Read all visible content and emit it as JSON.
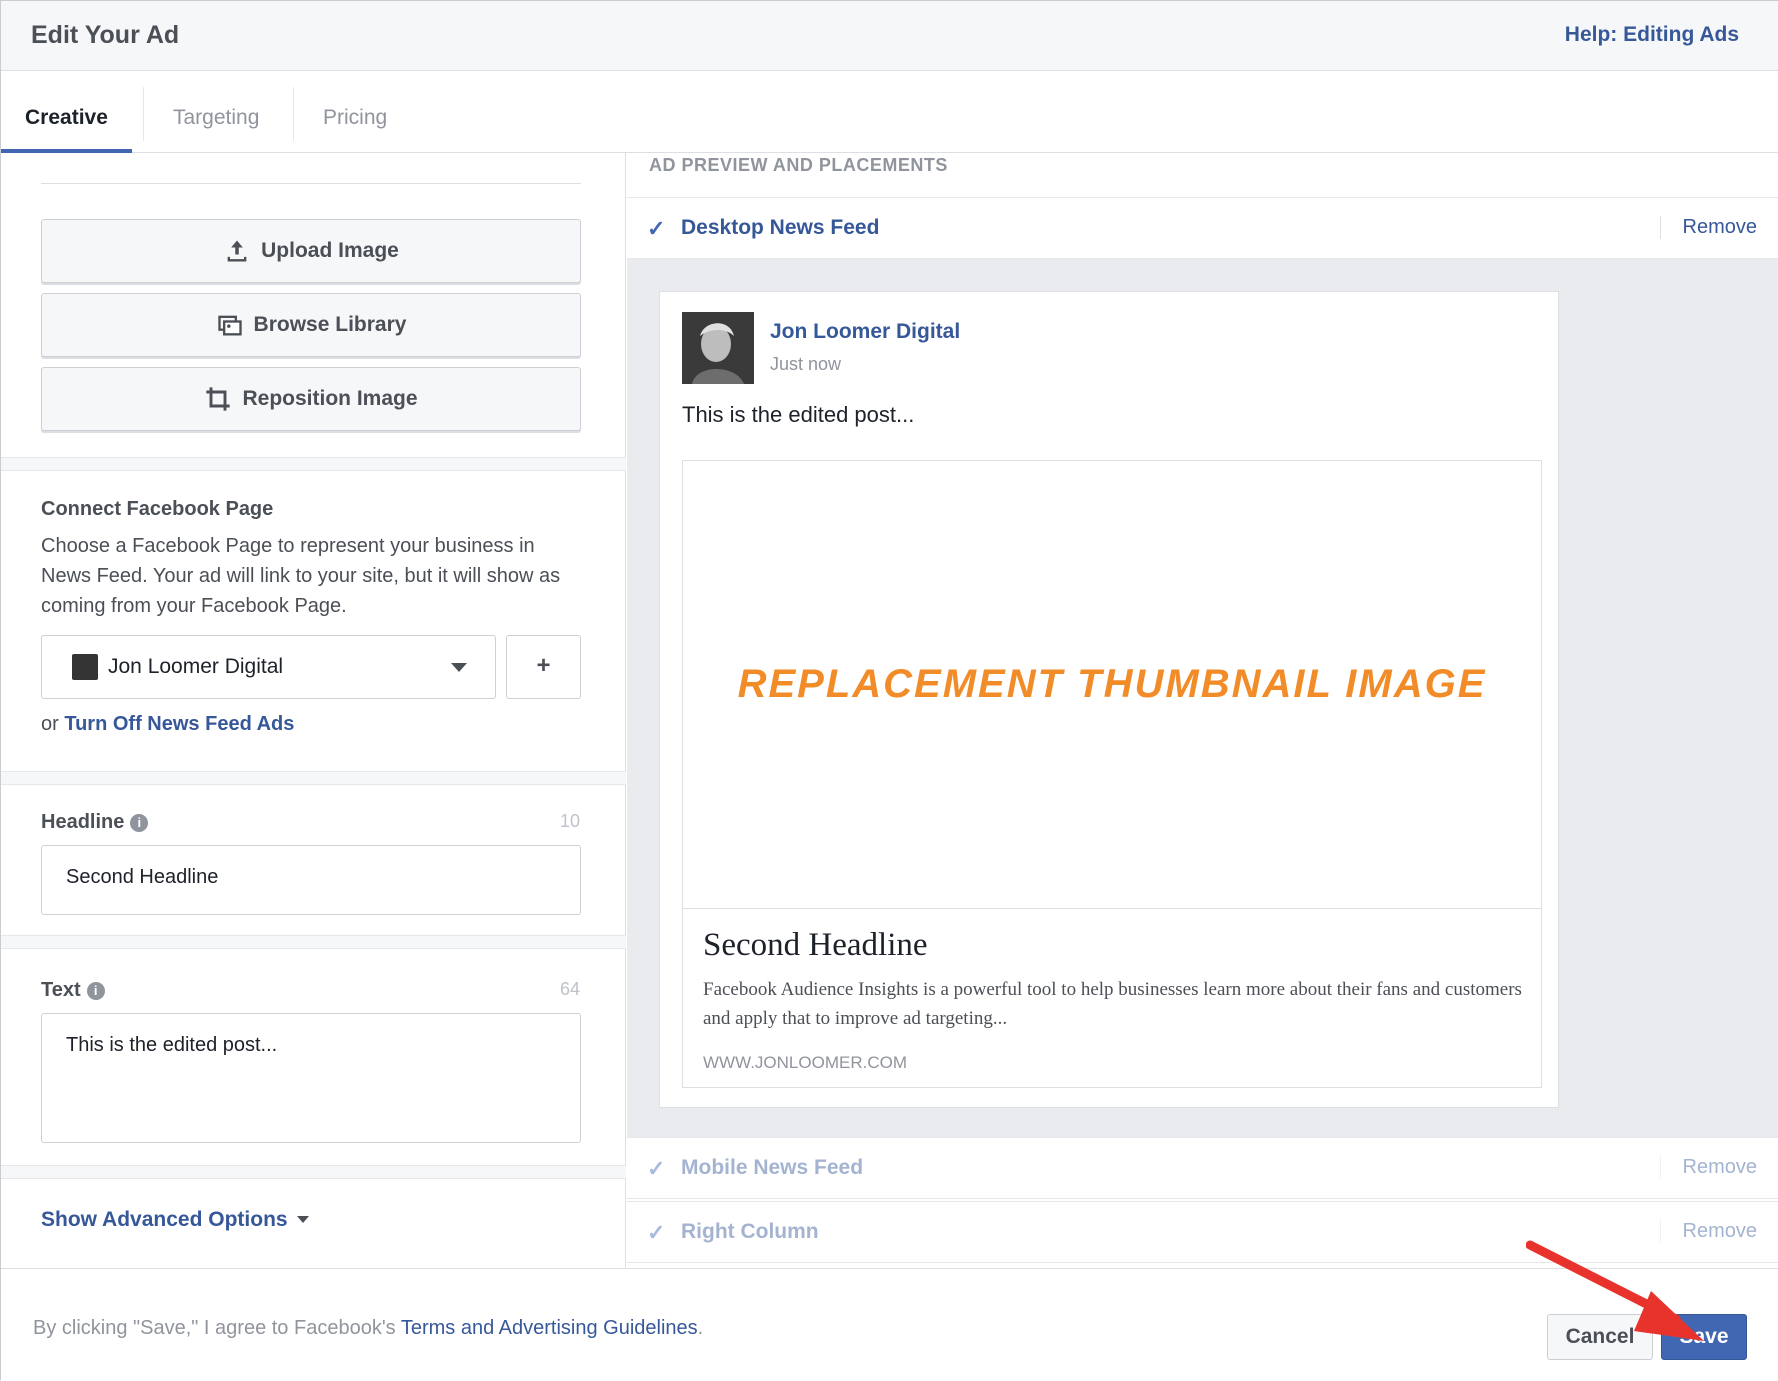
{
  "dialog": {
    "title": "Edit Your Ad",
    "help_link": "Help: Editing Ads"
  },
  "tabs": [
    {
      "label": "Creative",
      "active": true
    },
    {
      "label": "Targeting",
      "active": false
    },
    {
      "label": "Pricing",
      "active": false
    }
  ],
  "image_buttons": {
    "upload": "Upload Image",
    "browse": "Browse Library",
    "reposition": "Reposition Image"
  },
  "connect_page": {
    "label": "Connect Facebook Page",
    "description": "Choose a Facebook Page to represent your business in News Feed. Your ad will link to your site, but it will show as coming from your Facebook Page.",
    "selected_page": "Jon Loomer Digital",
    "add_label": "+",
    "or_text": "or",
    "turn_off_link": "Turn Off News Feed Ads"
  },
  "headline": {
    "label": "Headline",
    "counter": "10",
    "value": "Second Headline"
  },
  "text": {
    "label": "Text",
    "counter": "64",
    "value": "This is the edited post..."
  },
  "advanced_options": "Show Advanced Options",
  "preview": {
    "heading": "AD PREVIEW AND PLACEMENTS",
    "placements": [
      {
        "name": "Desktop News Feed",
        "remove": "Remove"
      },
      {
        "name": "Mobile News Feed",
        "remove": "Remove"
      },
      {
        "name": "Right Column",
        "remove": "Remove"
      }
    ],
    "post": {
      "page_name": "Jon Loomer Digital",
      "time": "Just now",
      "message": "This is the edited post...",
      "thumbnail_text": "REPLACEMENT THUMBNAIL IMAGE",
      "link_headline": "Second Headline",
      "link_description": "Facebook Audience Insights is a powerful tool to help businesses learn more about their fans and customers and apply that to improve ad targeting...",
      "domain": "WWW.JONLOOMER.COM"
    }
  },
  "footer": {
    "legal_prefix": "By clicking \"Save,\" I agree to Facebook's",
    "legal_link": "Terms and Advertising Guidelines",
    "legal_suffix": ".",
    "cancel": "Cancel",
    "save": "Save"
  },
  "colors": {
    "brand": "#4267b2",
    "link": "#365899",
    "thumbnail_text": "#f28c28",
    "annotation_arrow": "#e8332d"
  }
}
